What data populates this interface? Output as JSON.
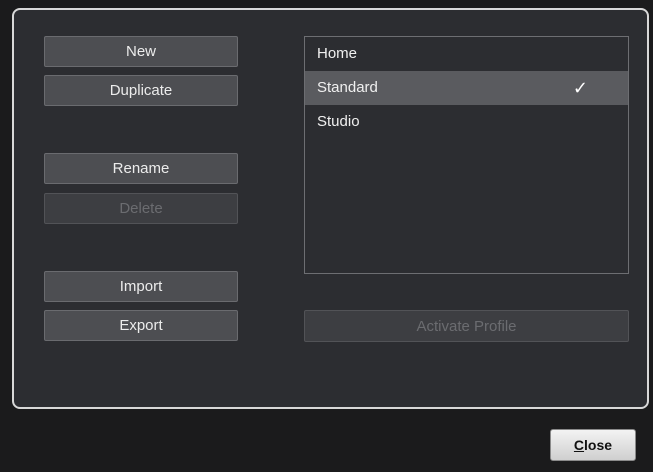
{
  "buttons": {
    "new": "New",
    "duplicate": "Duplicate",
    "rename": "Rename",
    "delete": "Delete",
    "import": "Import",
    "export": "Export"
  },
  "profiles": {
    "items": [
      {
        "label": "Home",
        "selected": false,
        "active": false
      },
      {
        "label": "Standard",
        "selected": true,
        "active": true,
        "check": "✓"
      },
      {
        "label": "Studio",
        "selected": false,
        "active": false
      }
    ]
  },
  "activate_label": "Activate Profile",
  "close": {
    "mnemonic": "C",
    "rest": "lose"
  },
  "icons": {
    "active_marker": "checkmark-icon"
  },
  "colors": {
    "panel_bg": "#2c2d31",
    "outer_bg": "#1b1b1c",
    "button_bg": "#4d4e52",
    "selected_row": "#5a5b5f",
    "panel_border": "#d8d8d8"
  }
}
